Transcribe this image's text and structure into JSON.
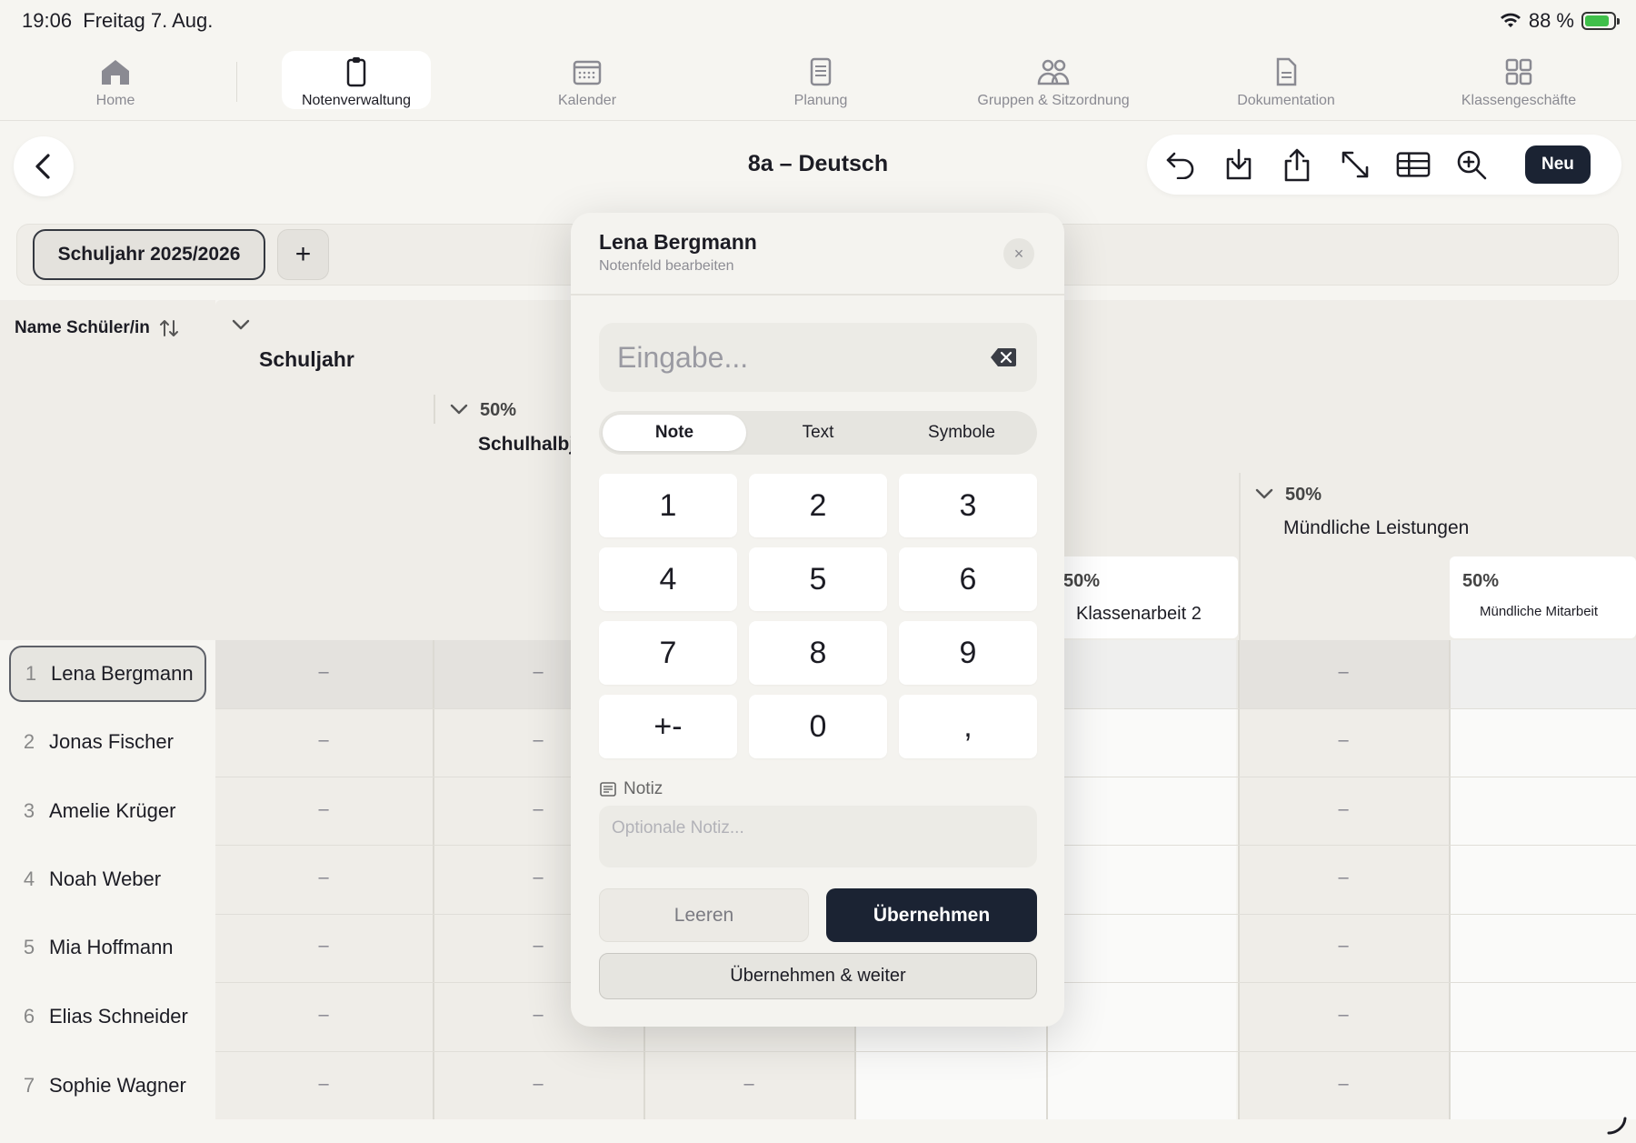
{
  "status": {
    "time": "19:06",
    "date": "Freitag 7. Aug.",
    "battery": "88 %"
  },
  "nav": {
    "home": "Home",
    "grades": "Notenverwaltung",
    "calendar": "Kalender",
    "planning": "Planung",
    "groups": "Gruppen & Sitzordnung",
    "docs": "Dokumentation",
    "class": "Klassengeschäfte"
  },
  "header": {
    "title": "8a – Deutsch",
    "new_label": "Neu"
  },
  "yearbar": {
    "year": "Schuljahr 2025/2026",
    "add": "+"
  },
  "grid": {
    "name_header": "Name Schüler/in",
    "level1_title": "Schuljahr",
    "level2_percent": "50%",
    "level2_title": "Schulhalbjahr",
    "oral_percent": "50%",
    "oral_title": "Mündliche Leistungen",
    "ka2_percent": "50%",
    "ka2_title": "Klassenarbeit 2",
    "mm_percent": "50%",
    "mm_title": "Mündliche Mitarbeit",
    "empty_value": "–",
    "students": [
      {
        "num": "1",
        "name": "Lena Bergmann"
      },
      {
        "num": "2",
        "name": "Jonas Fischer"
      },
      {
        "num": "3",
        "name": "Amelie Krüger"
      },
      {
        "num": "4",
        "name": "Noah Weber"
      },
      {
        "num": "5",
        "name": "Mia Hoffmann"
      },
      {
        "num": "6",
        "name": "Elias Schneider"
      },
      {
        "num": "7",
        "name": "Sophie Wagner"
      }
    ]
  },
  "modal": {
    "title": "Lena Bergmann",
    "subtitle": "Notenfeld bearbeiten",
    "close": "×",
    "input_placeholder": "Eingabe...",
    "input_value": "",
    "tabs": [
      "Note",
      "Text",
      "Symbole"
    ],
    "active_tab": "Note",
    "keys": [
      "1",
      "2",
      "3",
      "4",
      "5",
      "6",
      "7",
      "8",
      "9",
      "+-",
      "0",
      ","
    ],
    "notiz_label": "Notiz",
    "notiz_placeholder": "Optionale Notiz...",
    "clear": "Leeren",
    "apply": "Übernehmen",
    "apply_next": "Übernehmen & weiter"
  }
}
